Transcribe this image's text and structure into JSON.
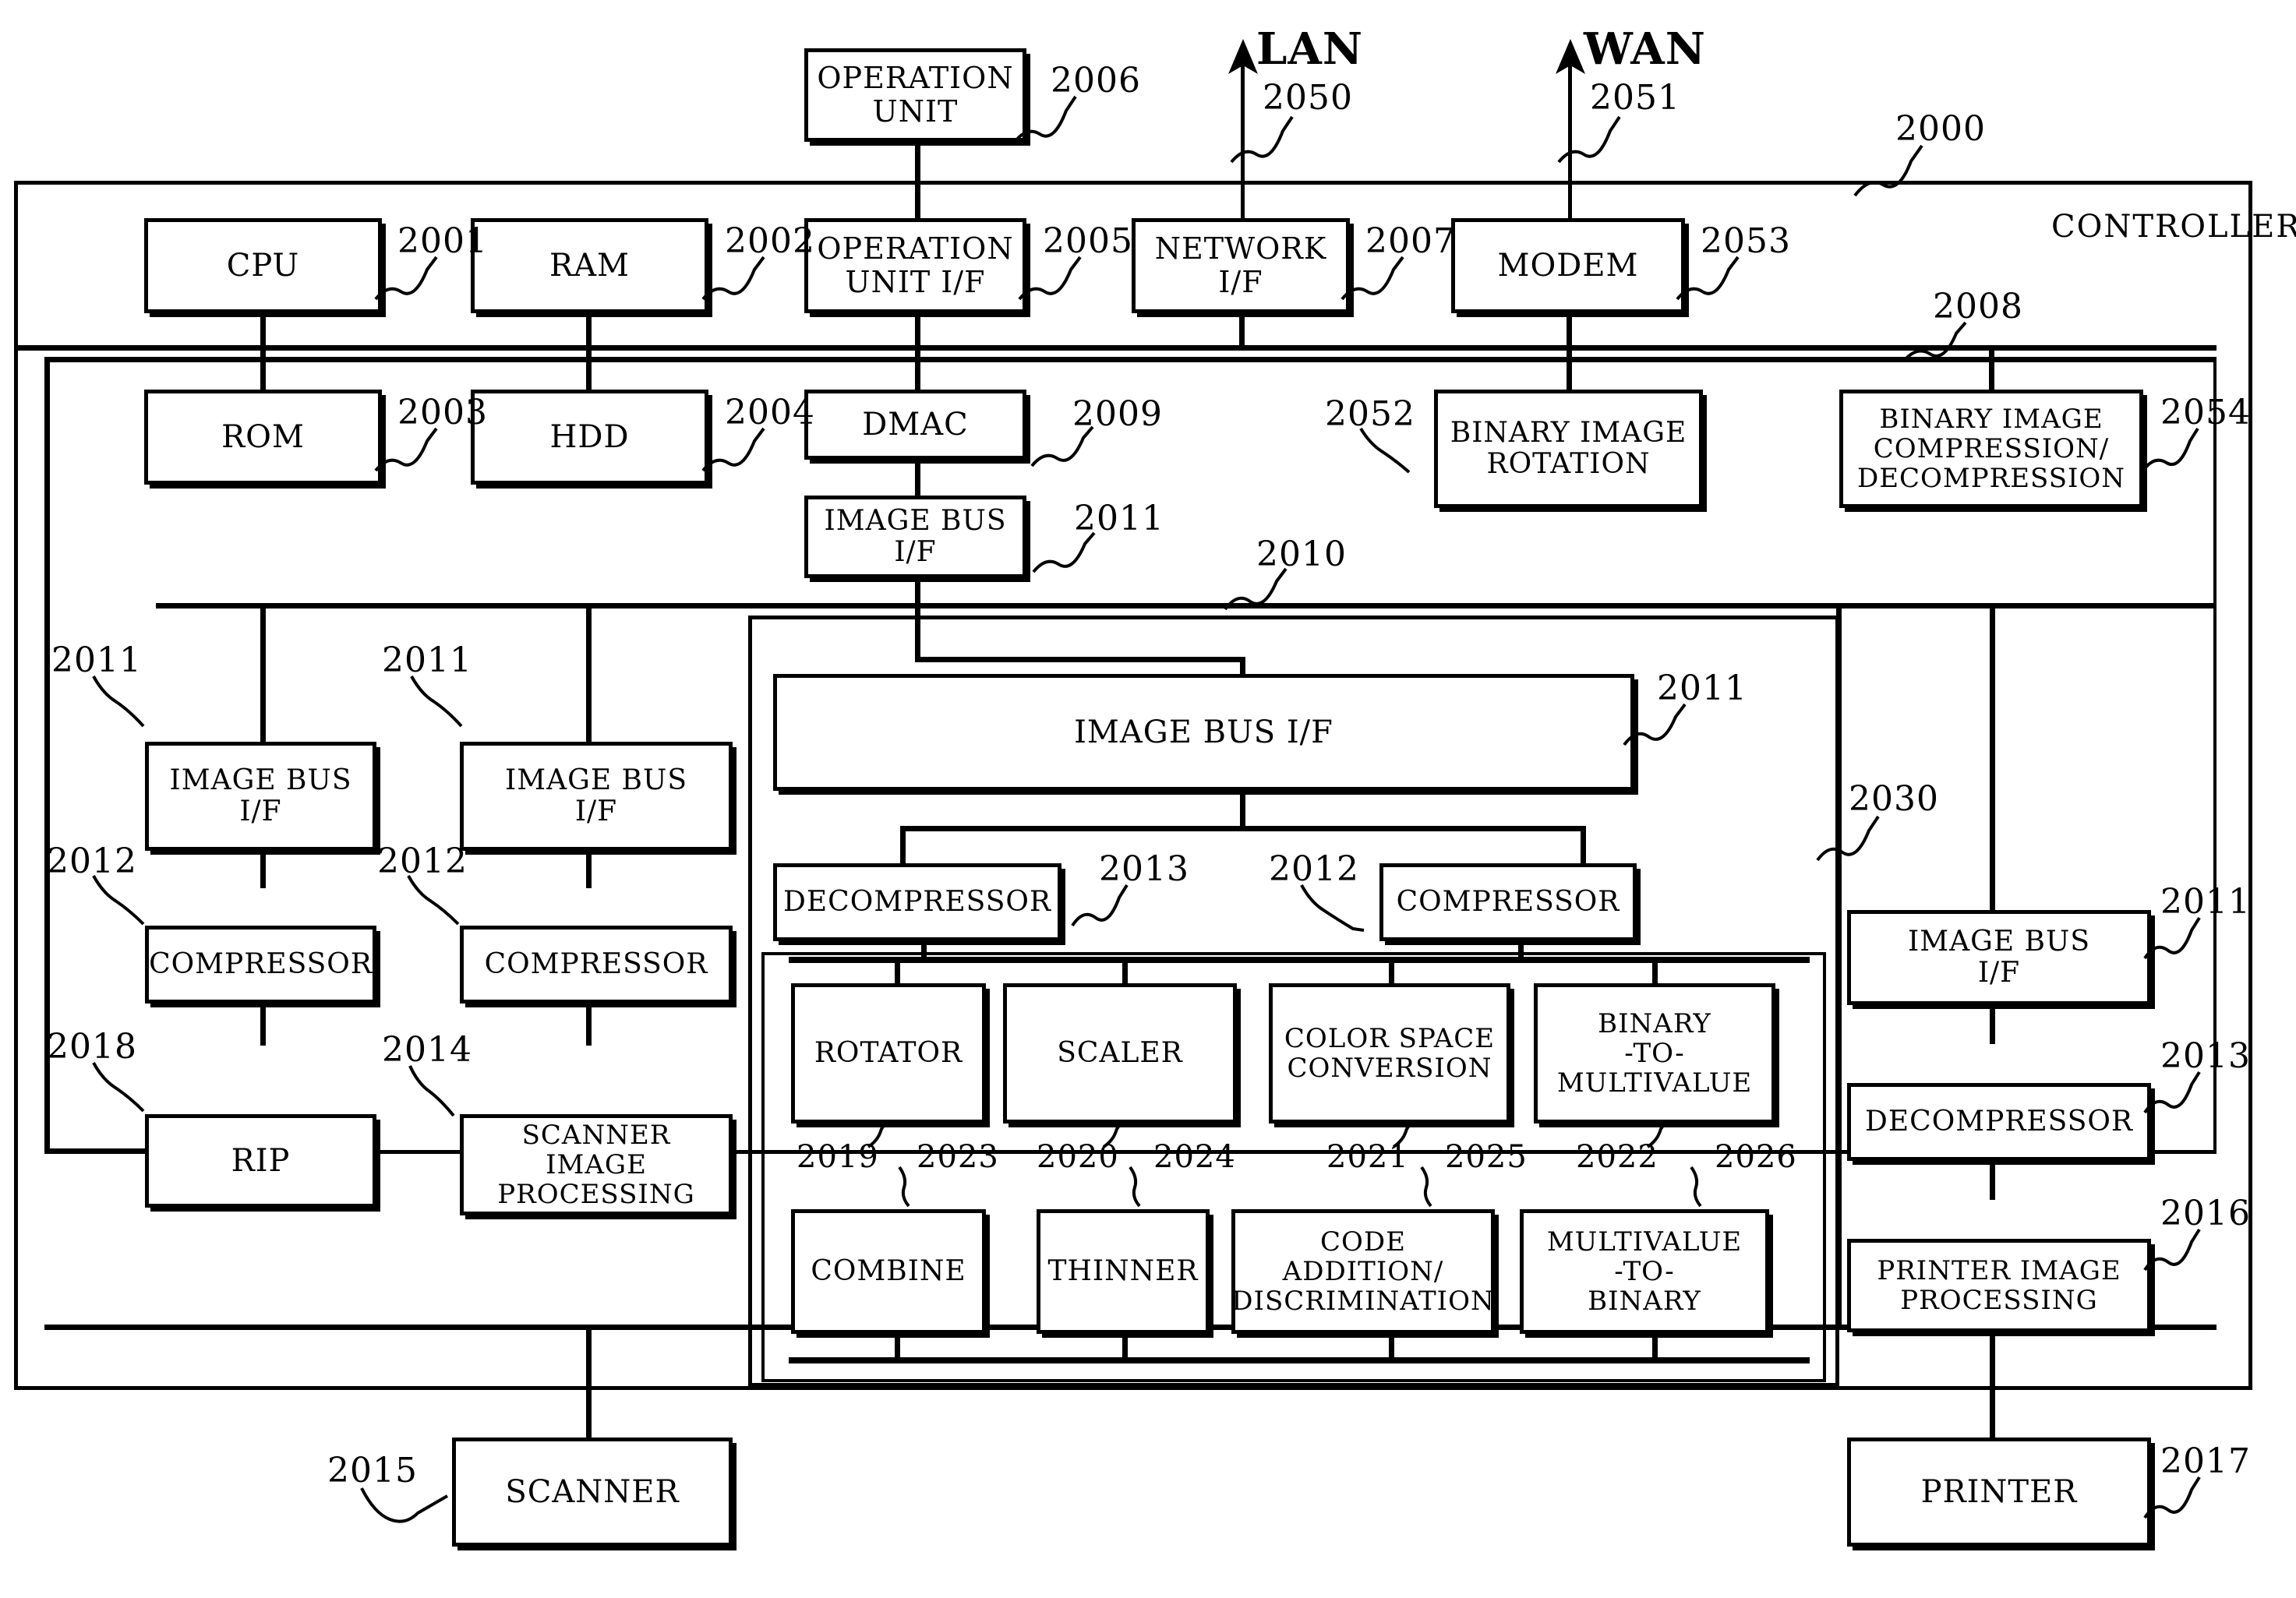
{
  "figure": {
    "type": "patent-block-diagram",
    "controller_label": "CONTROLLER",
    "external_signals": [
      {
        "name": "LAN",
        "ref": "2050"
      },
      {
        "name": "WAN",
        "ref": "2051"
      }
    ]
  },
  "refs": {
    "controller": "2000",
    "cpu": "2001",
    "ram": "2002",
    "rom": "2003",
    "hdd": "2004",
    "operation_unit_if": "2005",
    "operation_unit": "2006",
    "network_if": "2007",
    "system_bus": "2008",
    "dmac": "2009",
    "image_processor": "2010",
    "image_bus_if_a": "2011",
    "image_bus_if_b": "2011",
    "image_bus_if_c": "2011",
    "image_bus_if_d": "2011",
    "image_bus_if_e": "2011",
    "image_bus_if_f": "2011",
    "compressor_a": "2012",
    "compressor_b": "2012",
    "compressor_c": "2012",
    "decompressor_a": "2013",
    "decompressor_b": "2013",
    "scanner_image_processing": "2014",
    "scanner": "2015",
    "printer_image_processing": "2016",
    "printer": "2017",
    "rip": "2018",
    "rotator": "2019",
    "scaler": "2020",
    "color_space_conversion": "2021",
    "binary_to_multivalue": "2022",
    "combine": "2023",
    "thinner": "2024",
    "code_addition_discrimination": "2025",
    "multivalue_to_binary": "2026",
    "image_bus": "2030",
    "lan": "2050",
    "wan": "2051",
    "binary_image_rotation": "2052",
    "modem": "2053",
    "binary_image_compression_decompression": "2054"
  },
  "blocks": {
    "cpu": "CPU",
    "ram": "RAM",
    "operation_unit": "OPERATION\nUNIT",
    "operation_unit_if": "OPERATION\nUNIT I/F",
    "network_if": "NETWORK\nI/F",
    "modem": "MODEM",
    "rom": "ROM",
    "hdd": "HDD",
    "dmac": "DMAC",
    "image_bus_if_top": "IMAGE BUS\nI/F",
    "binary_image_rotation": "BINARY IMAGE\nROTATION",
    "binary_image_compression_decompression": "BINARY IMAGE\nCOMPRESSION/\nDECOMPRESSION",
    "image_bus_if_left": "IMAGE BUS\nI/F",
    "image_bus_if_mid": "IMAGE BUS\nI/F",
    "compressor_left": "COMPRESSOR",
    "compressor_mid": "COMPRESSOR",
    "rip": "RIP",
    "scanner_image_processing": "SCANNER IMAGE\nPROCESSING",
    "image_bus_if_center": "IMAGE BUS I/F",
    "decompressor_center": "DECOMPRESSOR",
    "compressor_center": "COMPRESSOR",
    "rotator": "ROTATOR",
    "scaler": "SCALER",
    "color_space_conversion": "COLOR SPACE\nCONVERSION",
    "binary_to_multivalue": "BINARY\n-TO-\nMULTIVALUE",
    "combine": "COMBINE",
    "thinner": "THINNER",
    "code_addition_discrimination": "CODE\nADDITION/\nDISCRIMINATION",
    "multivalue_to_binary": "MULTIVALUE\n-TO-\nBINARY",
    "image_bus_if_right": "IMAGE BUS\nI/F",
    "decompressor_right": "DECOMPRESSOR",
    "printer_image_processing": "PRINTER IMAGE\nPROCESSING",
    "scanner": "SCANNER",
    "printer": "PRINTER"
  }
}
